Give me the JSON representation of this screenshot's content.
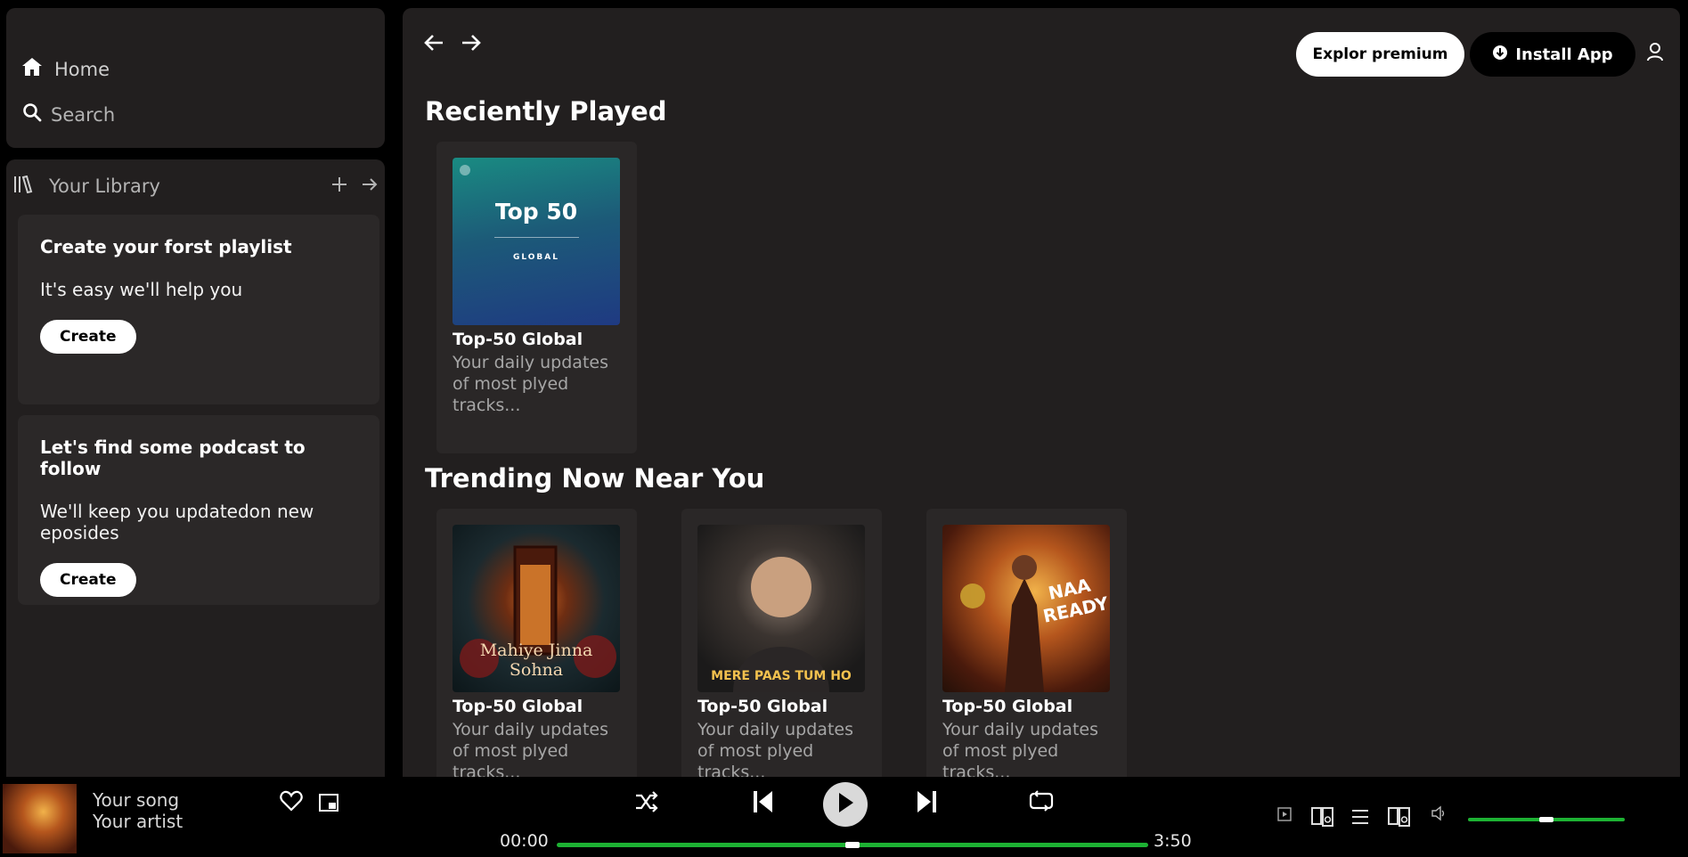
{
  "sidebar": {
    "nav": {
      "home": "Home",
      "search": "Search"
    },
    "library": {
      "title": "Your Library",
      "cards": [
        {
          "title": "Create your forst playlist",
          "text": "It's easy we'll help you",
          "button": "Create"
        },
        {
          "title": "Let's find some podcast to follow",
          "text": "We'll keep you updatedon new eposides",
          "button": "Create"
        }
      ]
    }
  },
  "header": {
    "premium_label": "Explor premium",
    "install_label": "Install App"
  },
  "main": {
    "recent": {
      "title": "Reciently Played",
      "items": [
        {
          "title": "Top-50 Global",
          "desc": "Your daily updates of most plyed tracks...",
          "art_title": "Top 50",
          "art_sub": "GLOBAL"
        }
      ]
    },
    "trending": {
      "title": "Trending Now Near You",
      "items": [
        {
          "title": "Top-50 Global",
          "desc": "Your daily updates of most plyed tracks...",
          "art_caption": "Mahiye Jinna Sohna"
        },
        {
          "title": "Top-50 Global",
          "desc": "Your daily updates of most plyed tracks...",
          "art_caption": "MERE PAAS TUM HO"
        },
        {
          "title": "Top-50 Global",
          "desc": "Your daily updates of most plyed tracks...",
          "art_caption": "NAA READY"
        }
      ]
    }
  },
  "player": {
    "song": "Your song",
    "artist": "Your artist",
    "time_current": "00:00",
    "time_total": "3:50",
    "progress": 0.5,
    "volume": 0.5
  },
  "colors": {
    "accent": "#1db233",
    "panel": "#221f1f",
    "card": "#2a2727"
  }
}
